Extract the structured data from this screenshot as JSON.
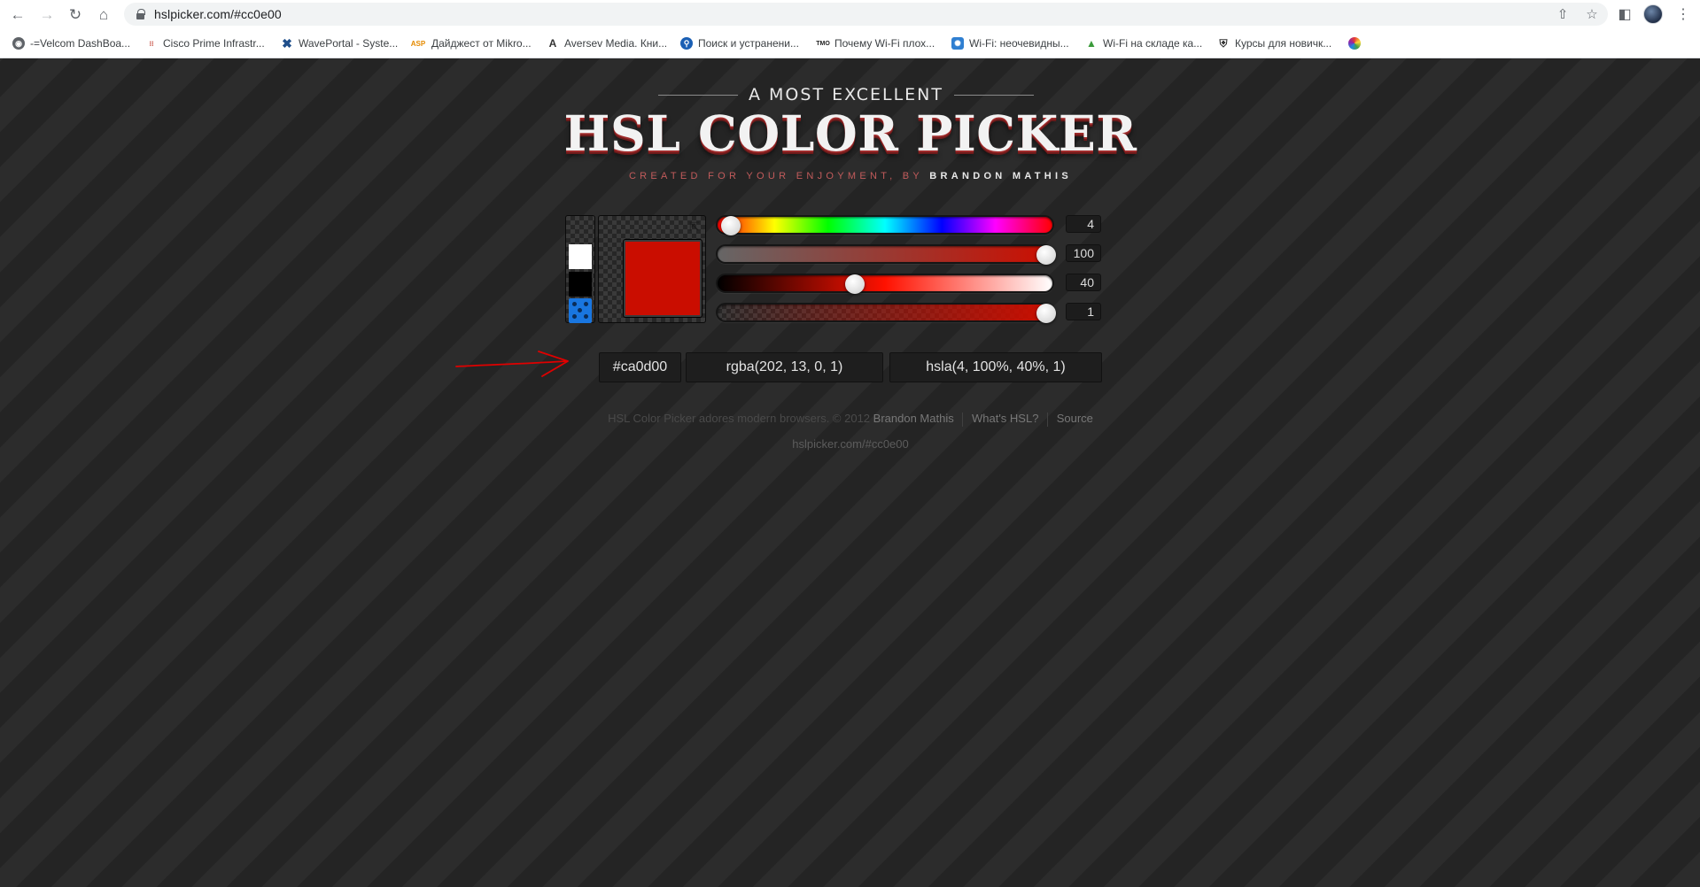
{
  "browser": {
    "url": "hslpicker.com/#cc0e00",
    "bookmarks": [
      {
        "label": "-=Velcom DashBoa...",
        "icon": "globe-icon"
      },
      {
        "label": "Cisco Prime Infrastr...",
        "icon": "cisco-icon"
      },
      {
        "label": "WavePortal - Syste...",
        "icon": "waveportal-icon"
      },
      {
        "label": "Дайджест от Mikro...",
        "icon": "asp-icon"
      },
      {
        "label": "Aversev Media. Кни...",
        "icon": "aversev-icon"
      },
      {
        "label": "Поиск и устранени...",
        "icon": "search-site-icon"
      },
      {
        "label": "Почему Wi-Fi плох...",
        "icon": "tmo-icon"
      },
      {
        "label": "Wi-Fi: неочевидны...",
        "icon": "wifi-article-icon"
      },
      {
        "label": "Wi-Fi на складе ка...",
        "icon": "warehouse-icon"
      },
      {
        "label": "Курсы для новичк...",
        "icon": "shield-icon"
      },
      {
        "label": "",
        "icon": "colorful-circle-icon"
      }
    ],
    "bookmark_icon_text": {
      "asp": "ASP",
      "tmo": "TMO",
      "aversev": "A"
    }
  },
  "header": {
    "kicker": "A MOST EXCELLENT",
    "title": "HSL COLOR PICKER",
    "subtitle_prefix": "CREATED FOR YOUR ENJOYMENT, BY",
    "author": "BRANDON MATHIS"
  },
  "picker": {
    "current_color": "#ca0d00",
    "sliders": [
      {
        "name": "hue",
        "value": "4",
        "position": 0.011
      },
      {
        "name": "saturation",
        "value": "100",
        "position": 1.0
      },
      {
        "name": "lightness",
        "value": "40",
        "position": 0.4
      },
      {
        "name": "alpha",
        "value": "1",
        "position": 1.0
      }
    ]
  },
  "fields": {
    "hex": "#ca0d00",
    "rgba": "rgba(202, 13, 0, 1)",
    "hsla": "hsla(4, 100%, 40%, 1)"
  },
  "footer": {
    "text": "HSL Color Picker adores modern browsers. © 2012",
    "author_link": "Brandon Mathis",
    "whats_hsl": "What's HSL?",
    "source": "Source",
    "permalink": "hslpicker.com/#cc0e00"
  },
  "annotation": {
    "color": "#e00000",
    "label": "red-arrow-annotation"
  }
}
